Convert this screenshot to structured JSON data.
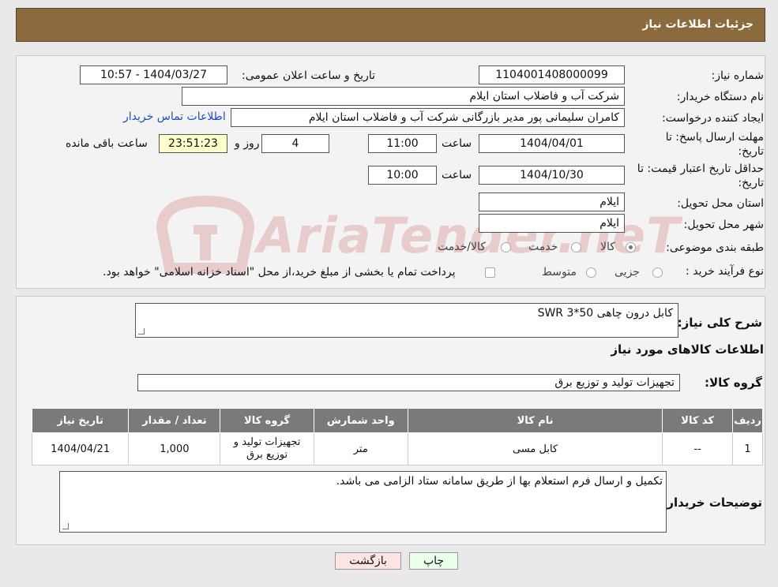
{
  "header": {
    "title": "جزئیات اطلاعات نیاز"
  },
  "watermark": {
    "text": "AriaTender.neT",
    "color": "#b40000"
  },
  "form": {
    "need_number_label": "شماره نیاز:",
    "need_number": "1104001408000099",
    "announce_label": "تاریخ و ساعت اعلان عمومی:",
    "announce_value": "1404/03/27 - 10:57",
    "buyer_label": "نام دستگاه خریدار:",
    "buyer_value": "شرکت آب و فاضلاب استان ایلام",
    "creator_label": "ایجاد کننده درخواست:",
    "creator_value": "کامران سلیمانی پور مدیر بازرگانی شرکت آب و فاضلاب استان ایلام",
    "contact_link": "اطلاعات تماس خریدار",
    "deadline_label_1": "مهلت ارسال پاسخ: تا",
    "deadline_label_2": "تاریخ:",
    "deadline_date": "1404/04/01",
    "time_label": "ساعت",
    "deadline_time": "11:00",
    "days_value": "4",
    "days_label": "روز و",
    "remaining_time": "23:51:23",
    "remaining_label": "ساعت باقی مانده",
    "validity_label_1": "حداقل تاریخ اعتبار قیمت: تا",
    "validity_label_2": "تاریخ:",
    "validity_date": "1404/10/30",
    "validity_time": "10:00",
    "province_label": "استان محل تحویل:",
    "province_value": "ایلام",
    "city_label": "شهر محل تحویل:",
    "city_value": "ایلام",
    "category_label": "طبقه بندی موضوعی:",
    "category_options": [
      "کالا",
      "خدمت",
      "کالا/خدمت"
    ],
    "category_selected": "کالا",
    "process_label": "نوع فرآیند خرید :",
    "process_options": [
      "جزیی",
      "متوسط"
    ],
    "process_note": "پرداخت تمام یا بخشی از مبلغ خرید،از محل \"اسناد خزانه اسلامی\" خواهد بود."
  },
  "details": {
    "summary_label": "شرح کلی نیاز:",
    "summary_value": "کابل درون چاهی SWR 3*50",
    "goods_heading": "اطلاعات کالاهای مورد نیاز",
    "group_label": "گروه کالا:",
    "group_value": "تجهیزات تولید و توزیع برق"
  },
  "table": {
    "headers": [
      "ردیف",
      "کد کالا",
      "نام کالا",
      "واحد شمارش",
      "گروه کالا",
      "تعداد / مقدار",
      "تاریخ نیاز"
    ],
    "rows": [
      [
        "1",
        "--",
        "کابل مسی",
        "متر",
        "تجهیزات تولید و توزیع برق",
        "1,000",
        "1404/04/21"
      ]
    ]
  },
  "notes": {
    "label": "توضیحات خریدار:",
    "value": "تکمیل و ارسال فرم استعلام بها از طریق سامانه ستاد الزامی می باشد."
  },
  "buttons": {
    "print": "چاپ",
    "back": "بازگشت"
  }
}
